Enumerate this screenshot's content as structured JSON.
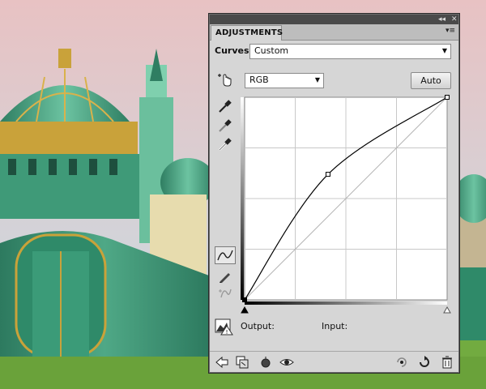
{
  "panel": {
    "tab_title": "ADJUSTMENTS",
    "collapse_glyph": "◂◂",
    "close_glyph": "✕",
    "menu_glyph": "▾≡"
  },
  "adjustment": {
    "label": "Curves",
    "preset_value": "Custom",
    "channel_value": "RGB",
    "auto_label": "Auto"
  },
  "readout": {
    "output_label": "Output:",
    "input_label": "Input:"
  },
  "curve": {
    "points": [
      [
        0,
        0
      ],
      [
        105,
        158
      ],
      [
        255,
        255
      ]
    ],
    "channel_color": "#000000"
  },
  "colors": {
    "panel_bg": "#d6d6d6",
    "titlebar": "#4a4a4a",
    "dome_green": "#3f9a78",
    "gold": "#c9a23a",
    "sky_top": "#e6c3c4",
    "sky_bottom": "#c9dfe5",
    "grass": "#6aa23a"
  },
  "icons": {
    "on_image": "finger-adjust-icon",
    "black_point": "eyedropper-black-icon",
    "gray_point": "eyedropper-gray-icon",
    "white_point": "eyedropper-white-icon",
    "curve_tool": "curve-edit-icon",
    "pencil_tool": "pencil-icon",
    "smooth_tool": "smooth-icon",
    "clipping": "clipping-warning-icon",
    "back": "back-arrow-icon",
    "clip_layer": "clip-to-layer-icon",
    "visibility_prev": "view-previous-icon",
    "visibility": "eye-icon",
    "reset_previous": "reset-previous-icon",
    "reset": "reset-icon",
    "delete": "trash-icon"
  }
}
